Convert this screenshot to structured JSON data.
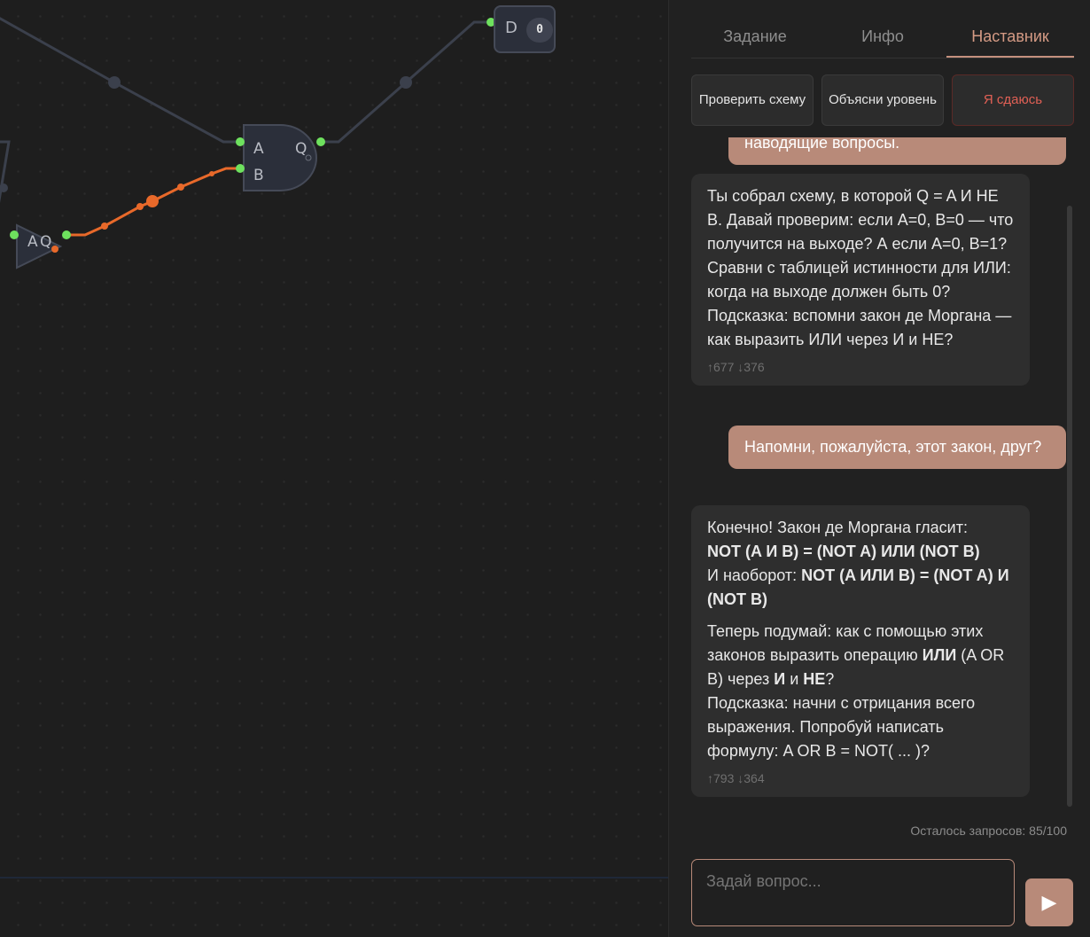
{
  "canvas": {
    "gate_and": {
      "in_a": "A",
      "in_b": "B",
      "out_q": "Q"
    },
    "gate_not": {
      "in_a": "A",
      "out_q": "Q"
    },
    "output_node": {
      "label": "D",
      "value": "0"
    },
    "colors": {
      "wire": "#3b404c",
      "active_wire": "#e8692a",
      "pin_on": "#6ee15e",
      "background": "#1e1e1e"
    }
  },
  "panel": {
    "tabs": [
      {
        "label": "Задание",
        "active": false
      },
      {
        "label": "Инфо",
        "active": false
      },
      {
        "label": "Наставник",
        "active": true
      }
    ],
    "actions": {
      "check": "Проверить схему",
      "explain": "Объясни уровень",
      "give_up": "Я сдаюсь"
    },
    "chat": {
      "partial_user": "наводящие вопросы.",
      "bot1": {
        "text": "Ты собрал схему, в которой Q = A И НЕ B. Давай проверим: если A=0, B=0 — что получится на выходе? А если A=0, B=1? Сравни с таблицей истинности для ИЛИ: когда на выходе должен быть 0? Подсказка: вспомни закон де Моргана — как выразить ИЛИ через И и НЕ?",
        "tokens": "↑677 ↓376"
      },
      "user2": "Напомни, пожалуйста, этот закон, друг?",
      "bot2": {
        "p1_intro": "Конечно! Закон де Моргана гласит:",
        "p1_law1": "NOT (A И B) = (NOT A) ИЛИ (NOT B)",
        "p1_mid": "И наоборот: ",
        "p1_law2": "NOT (A ИЛИ B) = (NOT A) И (NOT B)",
        "p2_a": "Теперь подумай: как с помощью этих законов выразить операцию ",
        "p2_or": "ИЛИ",
        "p2_b": " (A OR B) через ",
        "p2_and": "И",
        "p2_c": " и ",
        "p2_not": "НЕ",
        "p2_d": "?",
        "p2_hint": "Подсказка: начни с отрицания всего выражения. Попробуй написать формулу: A OR B = NOT( ... )?",
        "tokens": "↑793 ↓364"
      }
    },
    "remaining": "Осталось запросов: 85/100",
    "input": {
      "placeholder": "Задай вопрос..."
    },
    "send_icon": "play-icon",
    "accent": "#b88a79"
  }
}
